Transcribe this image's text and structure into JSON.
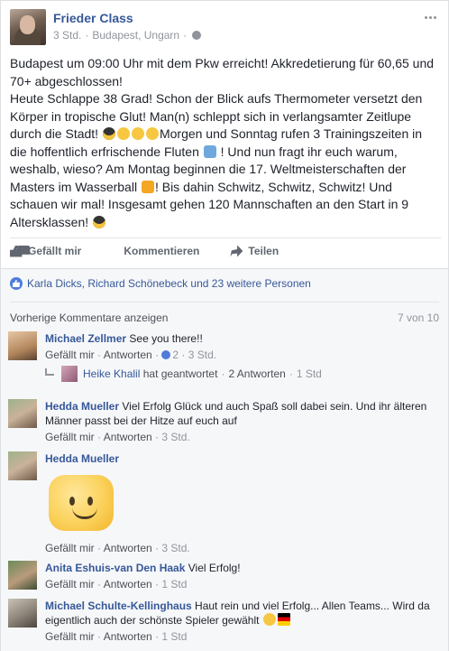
{
  "post": {
    "author": "Frieder Class",
    "time": "3 Std.",
    "location": "Budapest, Ungarn",
    "paragraph1": "Budapest um 09:00 Uhr mit dem Pkw erreicht! Akkredetierung für 60,65 und 70+ abgeschlossen!",
    "p2a": "Heute Schlappe 38 Grad! Schon der Blick aufs Thermometer versetzt den Körper in tropische Glut! Man(n) schleppt sich in verlangsamter Zeitlupe durch die Stadt!",
    "p2b": "Morgen und Sonntag rufen 3 Trainingszeiten in die hoffentlich erfrischende Fluten",
    "p2c": "! Und nun fragt ihr euch warum, weshalb, wieso? Am Montag beginnen die 17. Weltmeisterschaften der Masters im Wasserball",
    "p2d": "! Bis dahin Schwitz, Schwitz, Schwitz! Und schauen wir mal! Insgesamt gehen 120 Mannschaften an den Start in 9 Altersklassen!"
  },
  "actions": {
    "like": "Gefällt mir",
    "comment": "Kommentieren",
    "share": "Teilen"
  },
  "likes_summary": "Karla Dicks, Richard Schönebeck und 23 weitere Personen",
  "prev_comments": "Vorherige Kommentare anzeigen",
  "comment_count": "7 von 10",
  "labels": {
    "like": "Gefällt mir",
    "reply": "Antworten"
  },
  "comments": [
    {
      "name": "Michael Zellmer",
      "text": "See you there!!",
      "likes": "2",
      "time": "3 Std."
    },
    {
      "name": "Hedda Mueller",
      "text": "Viel Erfolg Glück und auch Spaß soll dabei sein. Und ihr älteren Männer passt bei der Hitze auf euch auf",
      "time": "3 Std."
    },
    {
      "name": "Hedda Mueller",
      "text": "",
      "time": "3 Std."
    },
    {
      "name": "Anita Eshuis-van Den Haak",
      "text": "Viel Erfolg!",
      "time": "1 Std"
    },
    {
      "name": "Michael Schulte-Kellinghaus",
      "text": "Haut rein und viel Erfolg... Allen Teams... Wird da eigentlich auch der schönste Spieler gewählt",
      "time": "1 Std"
    }
  ],
  "reply": {
    "name": "Heike Khalil",
    "text": "hat geantwortet",
    "count": "2 Antworten",
    "time": "1 Std"
  },
  "icons": [
    "thumbs-up-icon",
    "comment-icon",
    "share-icon",
    "globe-icon",
    "more-icon"
  ]
}
